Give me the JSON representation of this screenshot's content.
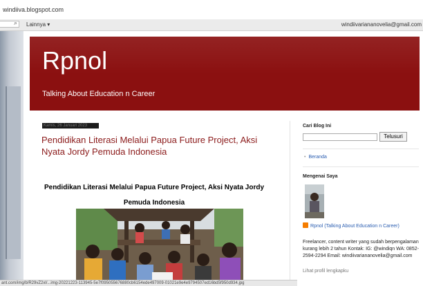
{
  "browser": {
    "url": "windiiva.blogspot.com"
  },
  "navbar": {
    "search_icon": "search-icon",
    "more_label": "Lainnya ▾",
    "user_email": "windiivariananovelia@gmail.com"
  },
  "blog": {
    "title": "Rpnol",
    "description": "Talking About Education n Career"
  },
  "post": {
    "date": "Kamis, 26 Januari 2023",
    "title": "Pendidikan Literasi Melalui Papua Future Project, Aksi Nyata Jordy Pemuda Indonesia",
    "heading_line1": "Pendidikan Literasi Melalui Papua Future Project, Aksi Nyata Jordy",
    "heading_line2": "Pemuda Indonesia"
  },
  "sidebar": {
    "search_title": "Cari Blog Ini",
    "search_button": "Telusuri",
    "home_link": "Beranda",
    "about_title": "Mengenai Saya",
    "profile_name": "Rpnol (Talking About Education n Career)",
    "bio": "Freelancer, content writer yang sudah berpengalaman kurang lebih 2 tahun Kontak: IG: @windiqn WA: 0852-2594-2294 Email: windiivariananovelia@gmail.com",
    "profile_link": "Lihat profil lengkapku"
  },
  "status": {
    "text": "ant.com/img/b/R29vZ2xl/...img-20221223-113945-5e7f095055676880cb6154ede497009-01021e9e4e9794507ed16bd5f950d934.jpg"
  },
  "colors": {
    "header_bg": "#8b1010",
    "post_title": "#8b1a1a",
    "link": "#2a5db0"
  }
}
